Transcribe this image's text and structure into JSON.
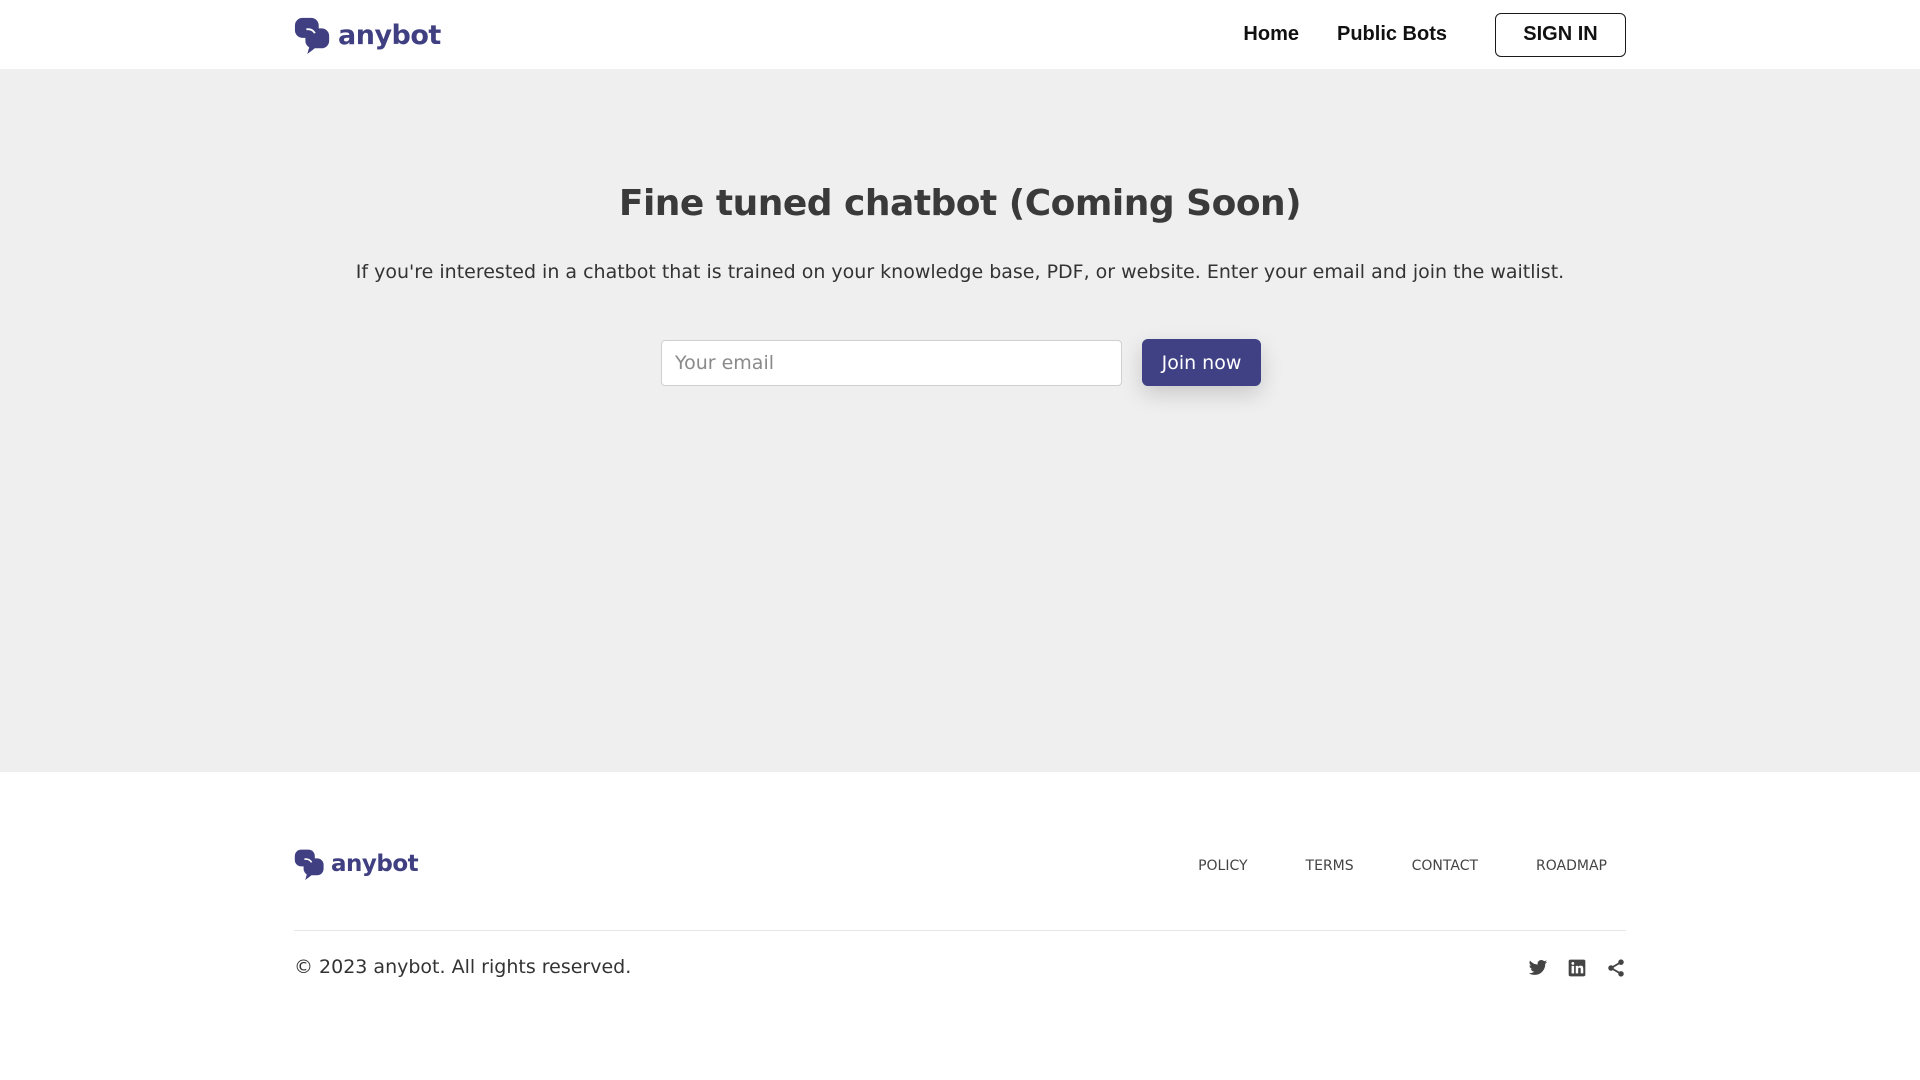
{
  "header": {
    "logo_text": "anybot",
    "nav": [
      {
        "label": "Home"
      },
      {
        "label": "Public Bots"
      }
    ],
    "signin_label": "SIGN IN"
  },
  "hero": {
    "title": "Fine tuned chatbot (Coming Soon)",
    "description": "If you're interested in a chatbot that is trained on your knowledge base, PDF, or website. Enter your email and join the waitlist.",
    "email_placeholder": "Your email",
    "email_value": "",
    "join_label": "Join now"
  },
  "footer": {
    "logo_text": "anybot",
    "links": [
      {
        "label": "POLICY"
      },
      {
        "label": "TERMS"
      },
      {
        "label": "CONTACT"
      },
      {
        "label": "ROADMAP"
      }
    ],
    "copyright": "© 2023 anybot. All rights reserved.",
    "social_icons": [
      "twitter-icon",
      "linkedin-icon",
      "share-icon"
    ]
  },
  "colors": {
    "brand": "#3f3f82",
    "button": "#3f4184",
    "hero_background": "#efefef",
    "page_background": "#ffffff"
  }
}
